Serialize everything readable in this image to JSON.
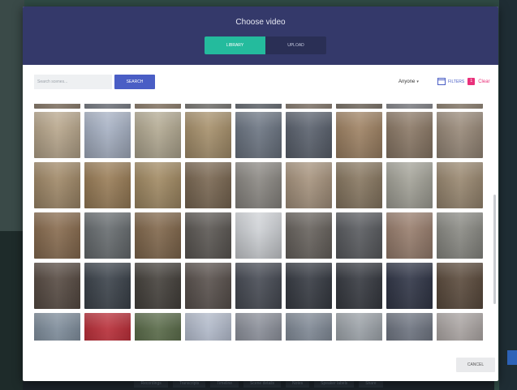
{
  "modal": {
    "title": "Choose video",
    "tabs": [
      {
        "label": "LIBRARY",
        "active": true
      },
      {
        "label": "UPLOAD",
        "active": false
      }
    ],
    "search": {
      "placeholder": "Search scenes...",
      "button_label": "SEARCH"
    },
    "owner_filter": {
      "label": "Anyone",
      "icon": "chevron-down-icon"
    },
    "filters": {
      "label": "FILTERS",
      "count": "1",
      "clear_label": "Clear",
      "icon": "calendar-icon"
    },
    "cancel_label": "CANCEL"
  },
  "thumbnail_grid": {
    "rows": [
      {
        "palette": [
          "#9a8b7a",
          "#8a8e96",
          "#a1917f",
          "#8e8c88",
          "#7a7f86",
          "#9b8f83",
          "#8c8378",
          "#9a9ba0",
          "#a39686"
        ]
      },
      {
        "palette": [
          "#b9a88e",
          "#a8b2c4",
          "#b4ab94",
          "#a8926e",
          "#6e7784",
          "#5d6470",
          "#a08466",
          "#8d7b69",
          "#9a8b7b"
        ]
      },
      {
        "palette": [
          "#a28b6b",
          "#9b7f5a",
          "#a38c66",
          "#7c6a55",
          "#8d8a85",
          "#a89580",
          "#8a7a64",
          "#a5a49a",
          "#9b8a73"
        ]
      },
      {
        "palette": [
          "#8a6e52",
          "#6a6f72",
          "#836a4f",
          "#5e5a56",
          "#cfd2d6",
          "#6a6560",
          "#5c5e62",
          "#9a8070",
          "#8c8c86"
        ]
      },
      {
        "palette": [
          "#5a4e46",
          "#3f464e",
          "#48443f",
          "#5c5450",
          "#4a4e57",
          "#3a3e46",
          "#3a3d44",
          "#34394a",
          "#5e4e40"
        ]
      },
      {
        "palette": [
          "#7e8c9a",
          "#b8303a",
          "#5a6b4a",
          "#b0b8c8",
          "#8a8e98",
          "#7f8894",
          "#9aa0a6",
          "#6e7480",
          "#a8a2a0"
        ]
      }
    ]
  },
  "background_tabs": [
    "Recordings",
    "Transcripts",
    "Timeline",
    "Scene details",
    "Notes",
    "Speaker labels",
    "Share"
  ]
}
